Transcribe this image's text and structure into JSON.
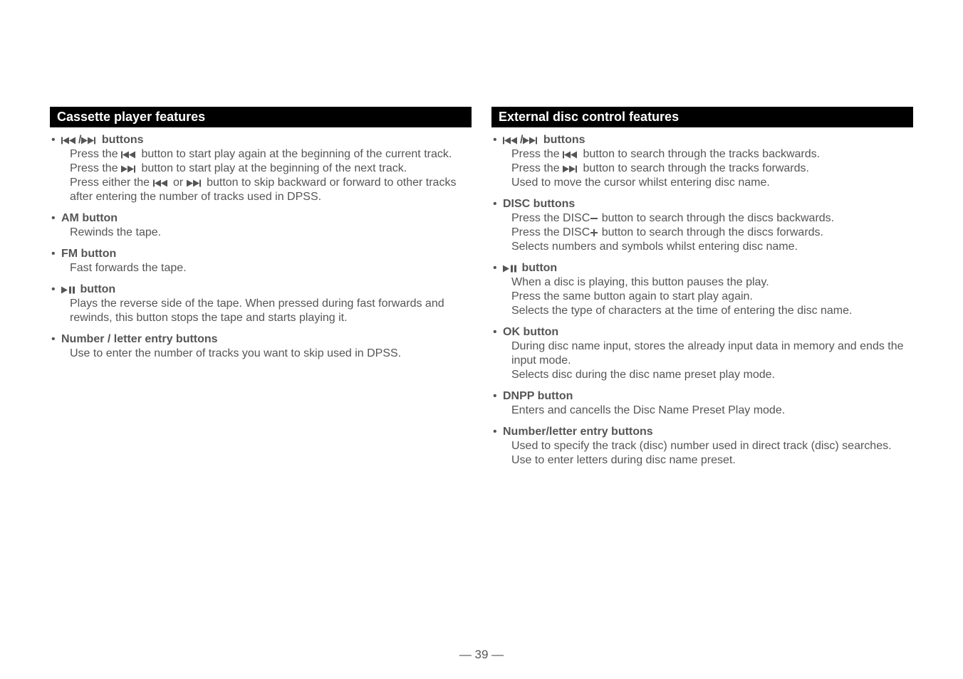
{
  "left": {
    "header": "Cassette player features",
    "items": [
      {
        "title_prefix_icon": "prev-next",
        "title_suffix": " buttons",
        "body_parts": [
          {
            "type": "line",
            "segments": [
              {
                "t": "Press the "
              },
              {
                "icon": "prev"
              },
              {
                "t": " button to start play again at the beginning of the current track."
              }
            ]
          },
          {
            "type": "line",
            "segments": [
              {
                "t": "Press the "
              },
              {
                "icon": "next"
              },
              {
                "t": " button to start play at the beginning of the next track."
              }
            ]
          },
          {
            "type": "line",
            "segments": [
              {
                "t": "Press either the "
              },
              {
                "icon": "prev"
              },
              {
                "t": " or "
              },
              {
                "icon": "next"
              },
              {
                "t": " button to skip backward or forward to other tracks after entering the number of tracks used in DPSS."
              }
            ]
          }
        ]
      },
      {
        "title": "AM button",
        "body_parts": [
          {
            "type": "line",
            "segments": [
              {
                "t": "Rewinds the tape."
              }
            ]
          }
        ]
      },
      {
        "title": "FM button",
        "body_parts": [
          {
            "type": "line",
            "segments": [
              {
                "t": "Fast forwards the tape."
              }
            ]
          }
        ]
      },
      {
        "title_prefix_icon": "playpause",
        "title_suffix": " button",
        "body_parts": [
          {
            "type": "line",
            "segments": [
              {
                "t": "Plays the reverse side of the tape. When pressed during fast forwards and rewinds, this button stops the tape and starts playing it."
              }
            ]
          }
        ]
      },
      {
        "title": "Number / letter entry buttons",
        "body_parts": [
          {
            "type": "line",
            "segments": [
              {
                "t": "Use to enter the number of tracks you want to skip used in DPSS."
              }
            ]
          }
        ]
      }
    ]
  },
  "right": {
    "header": "External disc control features",
    "items": [
      {
        "title_prefix_icon": "prev-next",
        "title_suffix": " buttons",
        "body_parts": [
          {
            "type": "line",
            "segments": [
              {
                "t": "Press the "
              },
              {
                "icon": "prev"
              },
              {
                "t": " button to search through the tracks backwards."
              }
            ]
          },
          {
            "type": "line",
            "segments": [
              {
                "t": "Press the "
              },
              {
                "icon": "next"
              },
              {
                "t": " button to search through the tracks forwards."
              }
            ]
          },
          {
            "type": "line",
            "segments": [
              {
                "t": "Used to move the cursor whilst entering disc name."
              }
            ]
          }
        ]
      },
      {
        "title": "DISC buttons",
        "body_parts": [
          {
            "type": "line",
            "segments": [
              {
                "t": "Press the DISC"
              },
              {
                "icon": "minus"
              },
              {
                "t": " button to search through the discs backwards."
              }
            ]
          },
          {
            "type": "line",
            "segments": [
              {
                "t": "Press the DISC"
              },
              {
                "icon": "plus"
              },
              {
                "t": " button to search through the discs forwards."
              }
            ]
          },
          {
            "type": "line",
            "segments": [
              {
                "t": "Selects numbers and symbols whilst entering disc name."
              }
            ]
          }
        ]
      },
      {
        "title_prefix_icon": "playpause",
        "title_suffix": " button",
        "body_parts": [
          {
            "type": "line",
            "segments": [
              {
                "t": "When a disc is playing, this button pauses the play."
              }
            ]
          },
          {
            "type": "line",
            "segments": [
              {
                "t": "Press the same button again to start play again."
              }
            ]
          },
          {
            "type": "line",
            "segments": [
              {
                "t": "Selects the type of characters at the time of entering the disc name."
              }
            ]
          }
        ]
      },
      {
        "title": "OK button",
        "body_parts": [
          {
            "type": "line",
            "segments": [
              {
                "t": "During disc name input, stores the already input data in memory and ends the input mode."
              }
            ]
          },
          {
            "type": "line",
            "segments": [
              {
                "t": "Selects disc during the disc name preset play mode."
              }
            ]
          }
        ]
      },
      {
        "title": "DNPP button",
        "body_parts": [
          {
            "type": "line",
            "segments": [
              {
                "t": "Enters and cancells the Disc Name Preset Play mode."
              }
            ]
          }
        ]
      },
      {
        "title": "Number/letter entry buttons",
        "body_parts": [
          {
            "type": "line",
            "segments": [
              {
                "t": "Used to specify the track (disc) number used in direct track (disc) searches."
              }
            ]
          },
          {
            "type": "line",
            "segments": [
              {
                "t": "Use to enter letters during disc name preset."
              }
            ]
          }
        ]
      }
    ]
  },
  "page_number": "— 39 —"
}
